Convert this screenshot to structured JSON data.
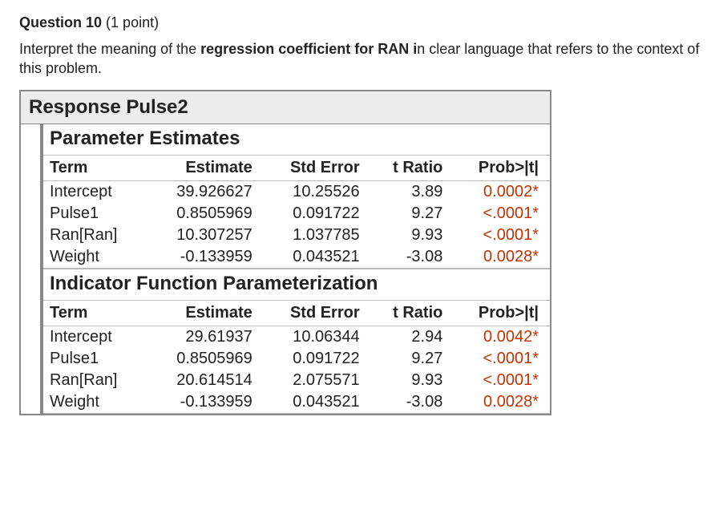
{
  "question": {
    "label": "Question 10",
    "points": "(1 point)",
    "prompt_before": "Interpret the meaning of the ",
    "prompt_bold": "regression coefficient for RAN i",
    "prompt_after": "n clear language that refers to the context of this problem."
  },
  "response_title": "Response Pulse2",
  "sections": [
    {
      "title": "Parameter Estimates",
      "headers": [
        "Term",
        "Estimate",
        "Std Error",
        "t Ratio",
        "Prob>|t|"
      ],
      "rows": [
        {
          "term": "Intercept",
          "estimate": "39.926627",
          "stderr": "10.25526",
          "tratio": "3.89",
          "prob": "0.0002*"
        },
        {
          "term": "Pulse1",
          "estimate": "0.8505969",
          "stderr": "0.091722",
          "tratio": "9.27",
          "prob": "<.0001*"
        },
        {
          "term": "Ran[Ran]",
          "estimate": "10.307257",
          "stderr": "1.037785",
          "tratio": "9.93",
          "prob": "<.0001*"
        },
        {
          "term": "Weight",
          "estimate": "-0.133959",
          "stderr": "0.043521",
          "tratio": "-3.08",
          "prob": "0.0028*"
        }
      ]
    },
    {
      "title": "Indicator Function Parameterization",
      "headers": [
        "Term",
        "Estimate",
        "Std Error",
        "t Ratio",
        "Prob>|t|"
      ],
      "rows": [
        {
          "term": "Intercept",
          "estimate": "29.61937",
          "stderr": "10.06344",
          "tratio": "2.94",
          "prob": "0.0042*"
        },
        {
          "term": "Pulse1",
          "estimate": "0.8505969",
          "stderr": "0.091722",
          "tratio": "9.27",
          "prob": "<.0001*"
        },
        {
          "term": "Ran[Ran]",
          "estimate": "20.614514",
          "stderr": "2.075571",
          "tratio": "9.93",
          "prob": "<.0001*"
        },
        {
          "term": "Weight",
          "estimate": "-0.133959",
          "stderr": "0.043521",
          "tratio": "-3.08",
          "prob": "0.0028*"
        }
      ]
    }
  ],
  "chart_data": {
    "type": "table",
    "title": "Response Pulse2 — Parameter Estimates",
    "columns": [
      "Term",
      "Estimate",
      "Std Error",
      "t Ratio",
      "Prob>|t|"
    ],
    "tables": [
      {
        "name": "Parameter Estimates",
        "rows": [
          [
            "Intercept",
            39.926627,
            10.25526,
            3.89,
            "0.0002*"
          ],
          [
            "Pulse1",
            0.8505969,
            0.091722,
            9.27,
            "<.0001*"
          ],
          [
            "Ran[Ran]",
            10.307257,
            1.037785,
            9.93,
            "<.0001*"
          ],
          [
            "Weight",
            -0.133959,
            0.043521,
            -3.08,
            "0.0028*"
          ]
        ]
      },
      {
        "name": "Indicator Function Parameterization",
        "rows": [
          [
            "Intercept",
            29.61937,
            10.06344,
            2.94,
            "0.0042*"
          ],
          [
            "Pulse1",
            0.8505969,
            0.091722,
            9.27,
            "<.0001*"
          ],
          [
            "Ran[Ran]",
            20.614514,
            2.075571,
            9.93,
            "<.0001*"
          ],
          [
            "Weight",
            -0.133959,
            0.043521,
            -3.08,
            "0.0028*"
          ]
        ]
      }
    ]
  }
}
